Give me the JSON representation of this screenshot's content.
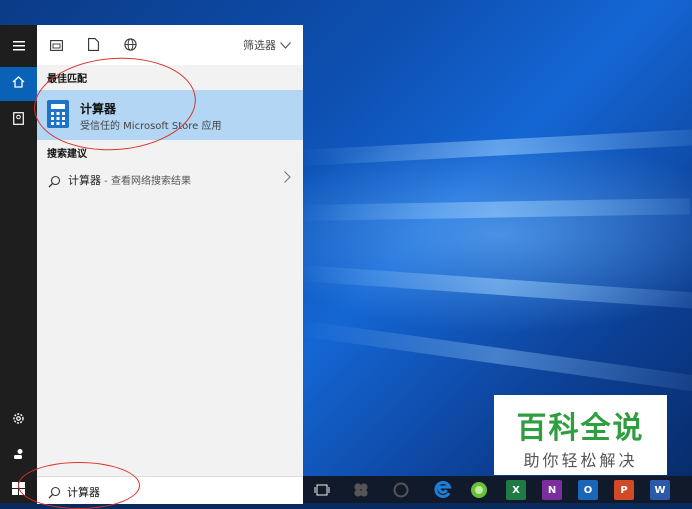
{
  "toolbar": {
    "filter_label": "筛选器"
  },
  "sections": {
    "best_match": "最佳匹配",
    "search_suggestions": "搜索建议"
  },
  "best_match": {
    "name": "计算器",
    "subtitle": "受信任的 Microsoft Store 应用"
  },
  "suggestion": {
    "term": "计算器",
    "hint": " - 查看网络搜索结果"
  },
  "search": {
    "value": "计算器"
  },
  "taskbar_apps": [
    {
      "icon": "task-view-icon"
    },
    {
      "icon": "app-icon"
    },
    {
      "icon": "edge-legacy-icon"
    },
    {
      "icon": "edge-icon",
      "color": "#1f7fd6"
    },
    {
      "icon": "browser-icon",
      "color": "#6abf3a"
    },
    {
      "icon": "excel-icon",
      "glyph": "X",
      "color": "#1f7a43"
    },
    {
      "icon": "onenote-icon",
      "glyph": "N",
      "color": "#7b2f9e"
    },
    {
      "icon": "outlook-icon",
      "glyph": "O",
      "color": "#1a66b8"
    },
    {
      "icon": "powerpoint-icon",
      "glyph": "P",
      "color": "#cf4a25"
    },
    {
      "icon": "word-icon",
      "glyph": "W",
      "color": "#2a5aa8"
    }
  ],
  "watermark": {
    "title": "百科全说",
    "subtitle": "助你轻松解决"
  },
  "colors": {
    "accent": "#0a62b8",
    "highlight": "#b3d6f5",
    "annotation": "#d9332b"
  }
}
